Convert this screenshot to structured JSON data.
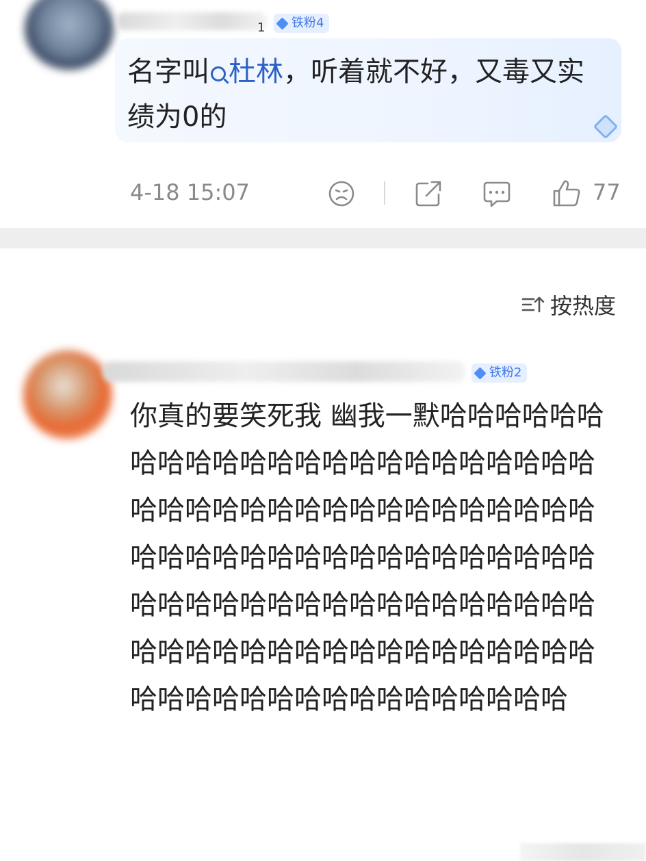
{
  "post1": {
    "badge": "铁粉4",
    "name_tail": "1",
    "text_before": "名字叫",
    "topic": "杜林",
    "text_after": "，听着就不好，又毒又实绩为0的",
    "timestamp": "4-18 15:07",
    "likes": "77"
  },
  "sort": {
    "label": "按热度"
  },
  "post2": {
    "badge": "铁粉2",
    "text": "你真的要笑死我 幽我一默哈哈哈哈哈哈哈哈哈哈哈哈哈哈哈哈哈哈哈哈哈哈哈哈哈哈哈哈哈哈哈哈哈哈哈哈哈哈哈哈哈哈哈哈哈哈哈哈哈哈哈哈哈哈哈哈哈哈哈哈哈哈哈哈哈哈哈哈哈哈哈哈哈哈哈哈哈哈哈哈哈哈哈哈哈哈哈哈哈哈哈哈哈哈哈哈哈哈哈哈哈哈哈哈哈哈哈"
  },
  "icons": {
    "dislike": "sad-face-icon",
    "share": "share-icon",
    "comment": "comment-icon",
    "like": "thumbs-up-icon",
    "sort": "sort-icon",
    "badge": "diamond-icon"
  },
  "colors": {
    "link": "#2c62c7",
    "badge_bg": "#e6efff",
    "badge_text": "#3f77e8",
    "meta_gray": "#8a8a8a"
  }
}
